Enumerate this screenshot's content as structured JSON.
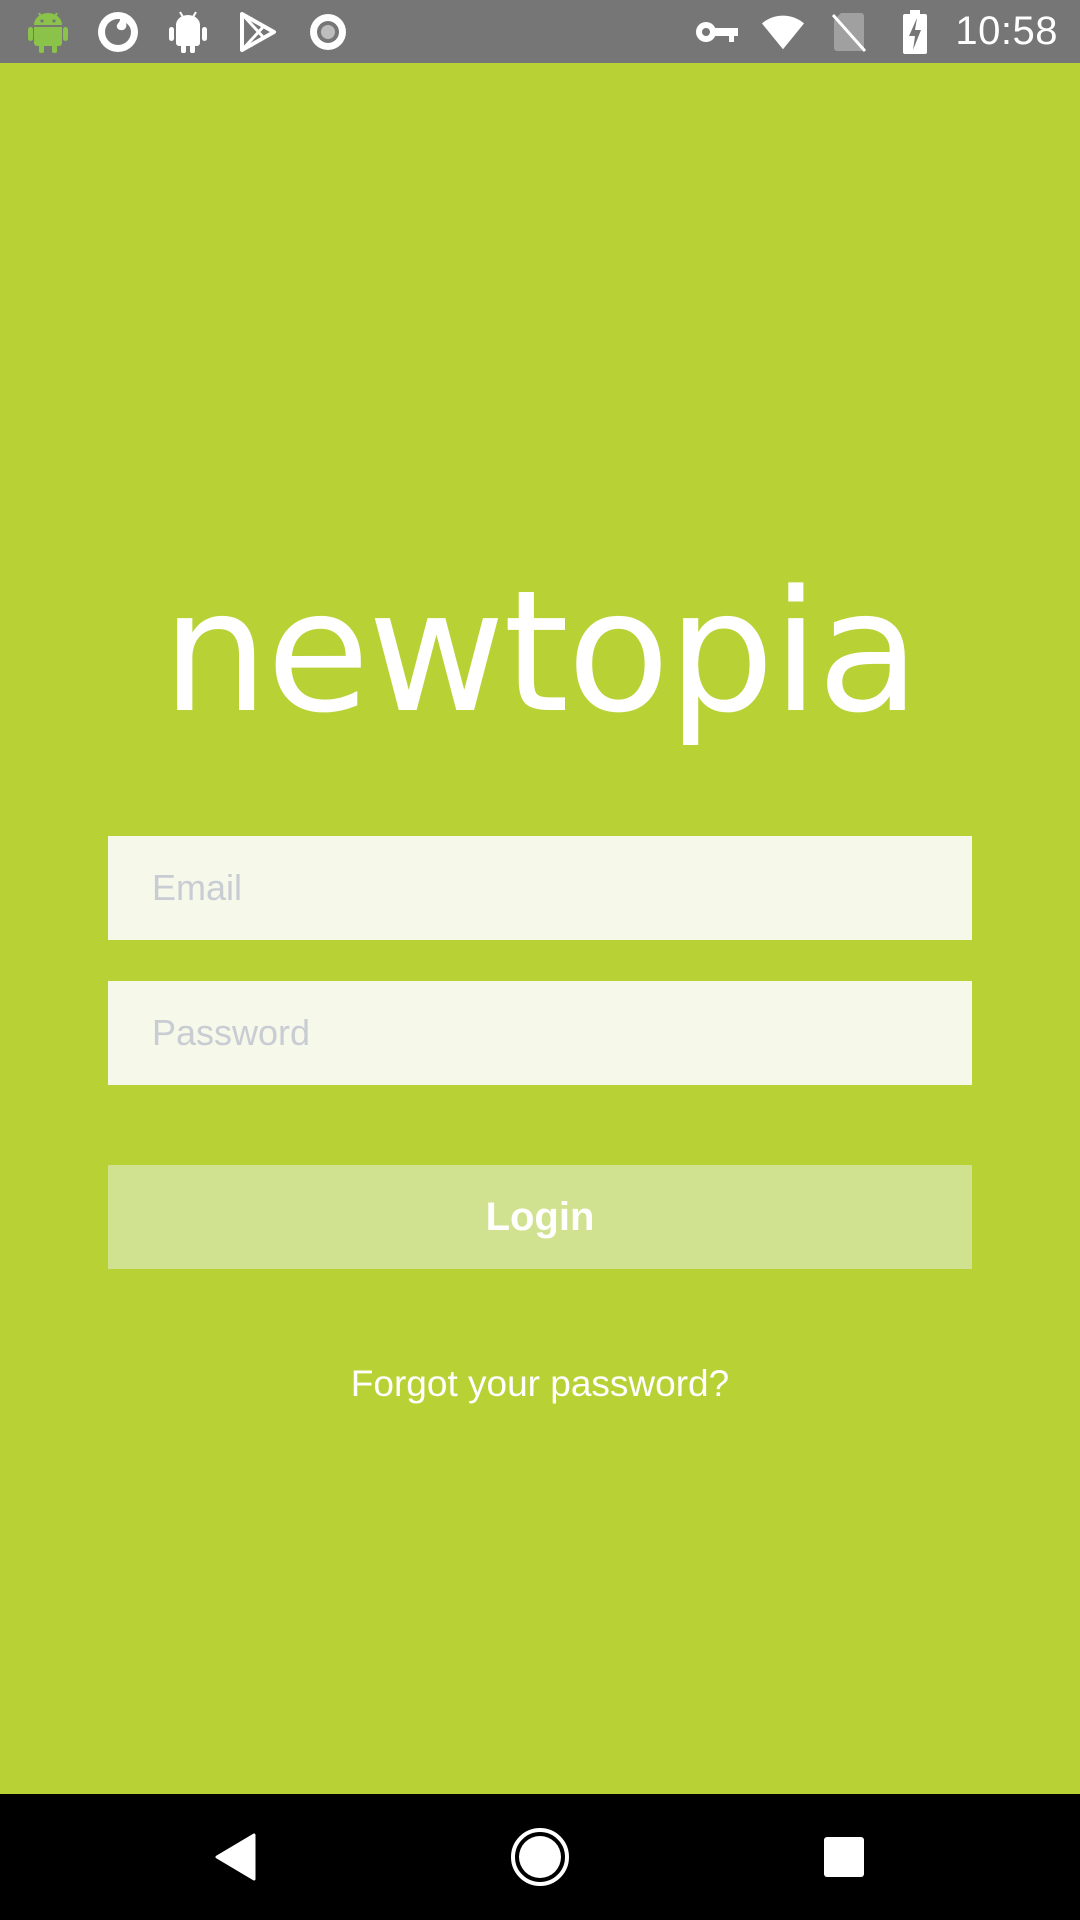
{
  "status_bar": {
    "left_icons": [
      "android-icon",
      "firefox-icon",
      "android-debug-icon",
      "play-store-icon",
      "record-icon"
    ],
    "right_icons": [
      "vpn-key-icon",
      "wifi-icon",
      "no-sim-icon",
      "battery-charging-icon"
    ],
    "time": "10:58",
    "colors": {
      "background": "#767676",
      "android_icon": "#8bc34a"
    }
  },
  "app": {
    "logo_text": "newtopia",
    "background_color": "#b8d236"
  },
  "login_form": {
    "email": {
      "placeholder": "Email",
      "value": ""
    },
    "password": {
      "placeholder": "Password",
      "value": ""
    },
    "login_label": "Login",
    "forgot_label": "Forgot your password?"
  },
  "nav_bar": {
    "buttons": [
      "back-icon",
      "home-icon",
      "recents-icon"
    ]
  }
}
